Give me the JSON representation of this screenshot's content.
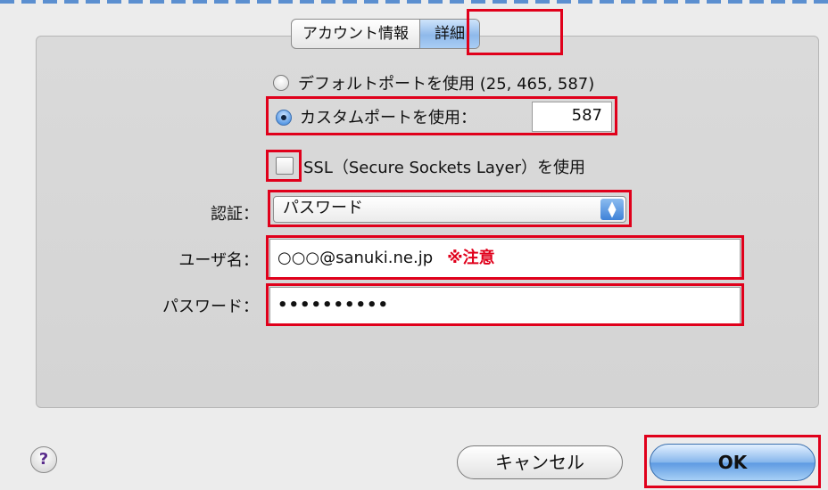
{
  "tabs": [
    "アカウント情報",
    "詳細"
  ],
  "active_tab": "詳細",
  "port": {
    "default_label": "デフォルトポートを使用 (25, 465, 587)",
    "custom_label": "カスタムポートを使用：",
    "custom_value": "587",
    "selected": "custom"
  },
  "ssl": {
    "label": "SSL（Secure Sockets Layer）を使用",
    "checked": false
  },
  "auth": {
    "label": "認証：",
    "value": "パスワード"
  },
  "username": {
    "label": "ユーザ名：",
    "value": "○○○@sanuki.ne.jp",
    "note": "※注意"
  },
  "password": {
    "label": "パスワード：",
    "value": "••••••••••"
  },
  "buttons": {
    "help": "?",
    "cancel": "キャンセル",
    "ok": "OK"
  },
  "colors": {
    "highlight": "#e0001b",
    "accent": "#5d9ae2"
  },
  "icons": {
    "help": "help-icon",
    "select": "updown-arrows-icon"
  }
}
